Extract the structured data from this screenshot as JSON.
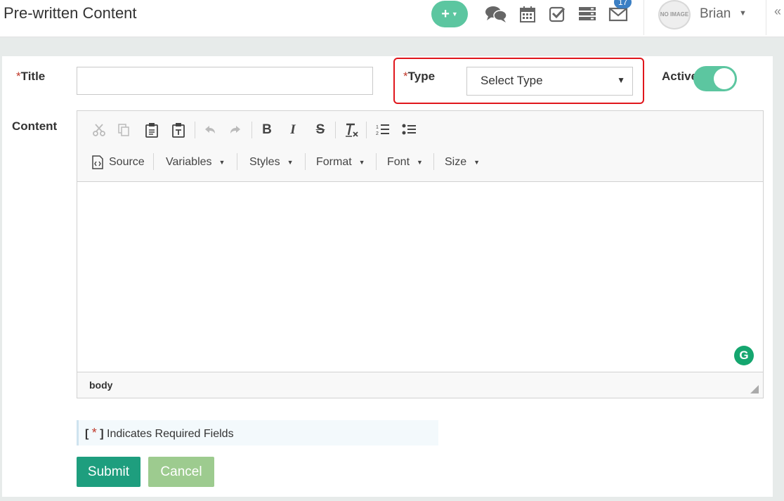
{
  "header": {
    "title": "Pre-written Content",
    "add_button": "+",
    "notification_count": "17",
    "user_name": "Brian",
    "avatar_text": "NO IMAGE",
    "collapse_symbol": "«"
  },
  "form": {
    "title_label": "Title",
    "required_star": "*",
    "type_label": "Type",
    "type_select_value": "Select Type",
    "active_label": "Active",
    "active_on": true,
    "content_label": "Content"
  },
  "editor": {
    "source_label": "Source",
    "variables_label": "Variables",
    "styles_label": "Styles",
    "format_label": "Format",
    "font_label": "Font",
    "size_label": "Size",
    "grammarly_glyph": "G",
    "path": "body"
  },
  "notice": {
    "open_bracket": "[",
    "star": "*",
    "close_bracket": "]",
    "text": "Indicates Required Fields"
  },
  "actions": {
    "submit_label": "Submit",
    "cancel_label": "Cancel"
  },
  "colors": {
    "accent": "#5cc6a0",
    "submit": "#1e9e7e",
    "cancel": "#9dcb8f",
    "highlight": "#e0161c",
    "badge": "#3b7fc4"
  }
}
